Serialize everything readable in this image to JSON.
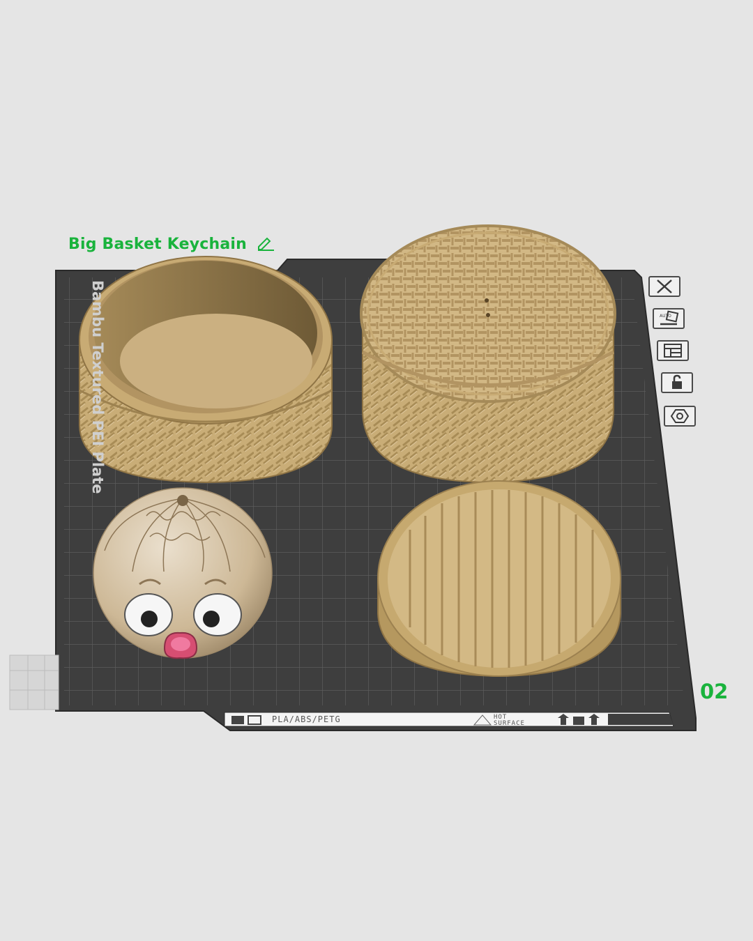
{
  "plate": {
    "title": "Big Basket Keychain",
    "number": "02",
    "side_label": "Bambu Textured PEI Plate",
    "filament_label": "PLA/ABS/PETG",
    "warning_label": "HOT SURFACE"
  },
  "toolbar": {
    "buttons": [
      {
        "icon": "close-x-icon",
        "label": "delete-plate"
      },
      {
        "icon": "auto-orient-icon",
        "label": "auto-orient"
      },
      {
        "icon": "arrange-icon",
        "label": "arrange"
      },
      {
        "icon": "lock-icon",
        "label": "lock"
      },
      {
        "icon": "settings-hex-icon",
        "label": "plate-settings"
      }
    ]
  },
  "objects": [
    {
      "name": "open-basket"
    },
    {
      "name": "closed-basket-with-lid"
    },
    {
      "name": "steamed-bun-face"
    },
    {
      "name": "basket-lid-slats"
    }
  ],
  "colors": {
    "plate": "#3d3d3d",
    "grid": "#5a5a5a",
    "model": "#cdb27d",
    "model_shadow": "#8f7445",
    "bun": "#d9c8ad",
    "accent": "#19b33c",
    "background": "#e5e5e5"
  }
}
